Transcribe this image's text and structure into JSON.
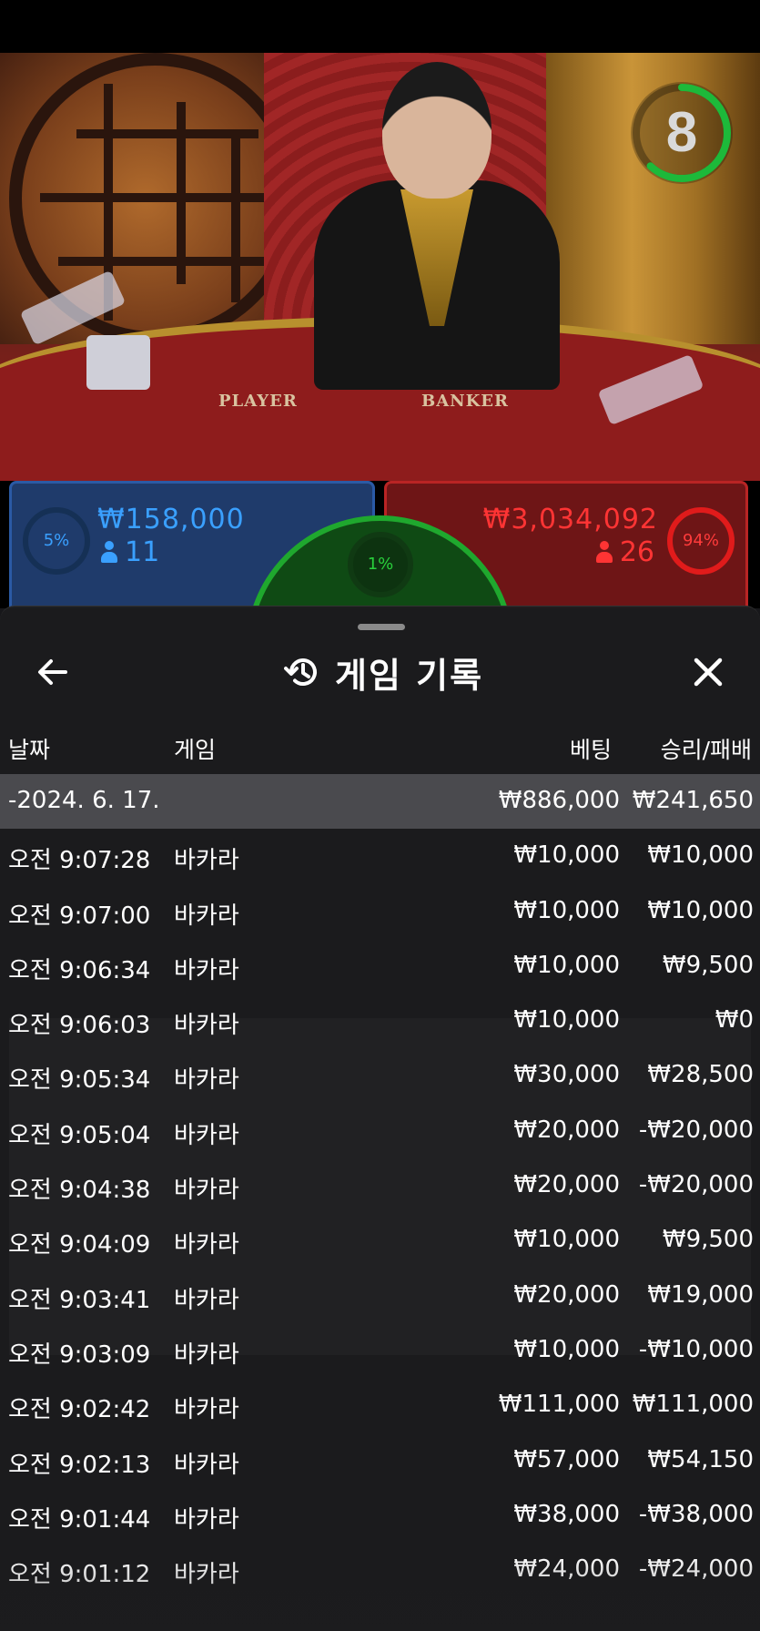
{
  "timer": {
    "value": "8",
    "progress": 0.62,
    "ring_color": "#1db93a"
  },
  "table": {
    "player_label": "PLAYER",
    "banker_label": "BANKER"
  },
  "bets": {
    "player": {
      "percent": "5%",
      "amount": "₩158,000",
      "users": "11",
      "color": "#3aa0ff"
    },
    "tie": {
      "percent": "1%",
      "color": "#29d03c"
    },
    "banker": {
      "percent": "94%",
      "amount": "₩3,034,092",
      "users": "26",
      "color": "#ff3434"
    }
  },
  "history": {
    "title": "게임 기록",
    "icons": {
      "back": "arrow-left-icon",
      "history": "history-clock-icon",
      "close": "close-icon"
    },
    "columns": {
      "date": "날짜",
      "game": "게임",
      "bet": "베팅",
      "result": "승리/패배"
    },
    "group": {
      "date": "-2024. 6. 17.",
      "bet": "₩886,000",
      "result": "₩241,650"
    },
    "rows": [
      {
        "time": "오전 9:07:28",
        "game": "바카라",
        "bet": "₩10,000",
        "result": "₩10,000"
      },
      {
        "time": "오전 9:07:00",
        "game": "바카라",
        "bet": "₩10,000",
        "result": "₩10,000"
      },
      {
        "time": "오전 9:06:34",
        "game": "바카라",
        "bet": "₩10,000",
        "result": "₩9,500"
      },
      {
        "time": "오전 9:06:03",
        "game": "바카라",
        "bet": "₩10,000",
        "result": "₩0"
      },
      {
        "time": "오전 9:05:34",
        "game": "바카라",
        "bet": "₩30,000",
        "result": "₩28,500"
      },
      {
        "time": "오전 9:05:04",
        "game": "바카라",
        "bet": "₩20,000",
        "result": "-₩20,000"
      },
      {
        "time": "오전 9:04:38",
        "game": "바카라",
        "bet": "₩20,000",
        "result": "-₩20,000"
      },
      {
        "time": "오전 9:04:09",
        "game": "바카라",
        "bet": "₩10,000",
        "result": "₩9,500"
      },
      {
        "time": "오전 9:03:41",
        "game": "바카라",
        "bet": "₩20,000",
        "result": "₩19,000"
      },
      {
        "time": "오전 9:03:09",
        "game": "바카라",
        "bet": "₩10,000",
        "result": "-₩10,000"
      },
      {
        "time": "오전 9:02:42",
        "game": "바카라",
        "bet": "₩111,000",
        "result": "₩111,000"
      },
      {
        "time": "오전 9:02:13",
        "game": "바카라",
        "bet": "₩57,000",
        "result": "₩54,150"
      },
      {
        "time": "오전 9:01:44",
        "game": "바카라",
        "bet": "₩38,000",
        "result": "-₩38,000"
      },
      {
        "time": "오전 9:01:12",
        "game": "바카라",
        "bet": "₩24,000",
        "result": "-₩24,000"
      }
    ]
  }
}
